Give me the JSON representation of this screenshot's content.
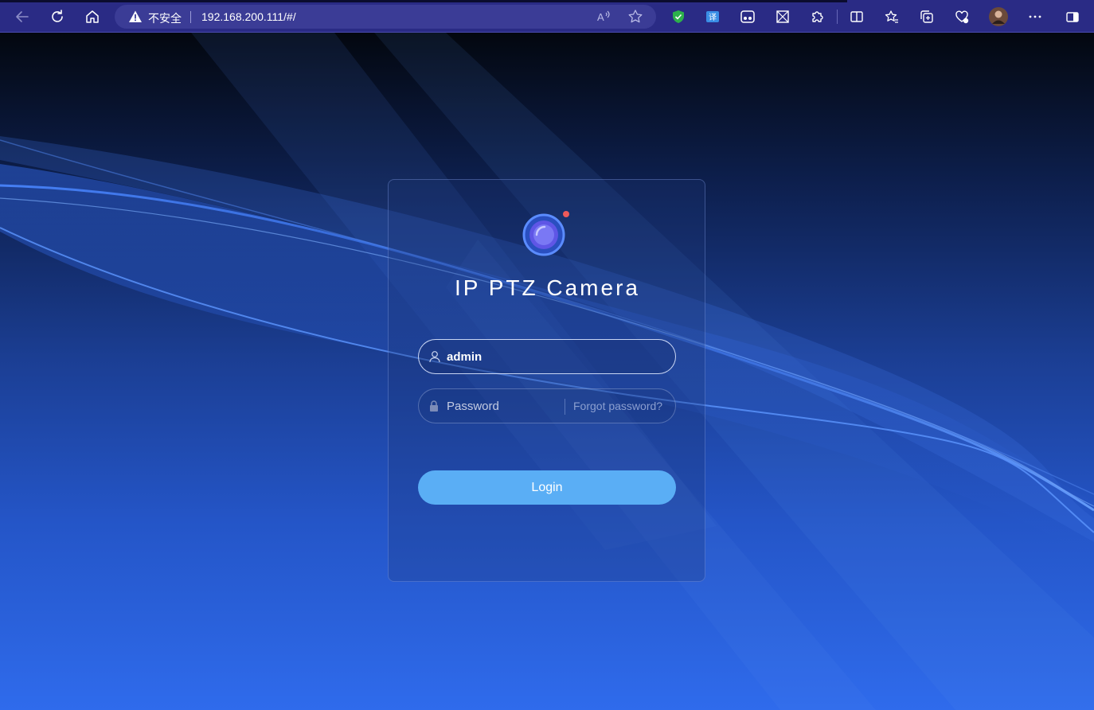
{
  "browser": {
    "security_label": "不安全",
    "url": "192.168.200.111/#/",
    "accent": "#2a2b85"
  },
  "login": {
    "title": "IP PTZ Camera",
    "username_value": "admin",
    "password_placeholder": "Password",
    "forgot_label": "Forgot password?",
    "login_label": "Login",
    "button_color": "#5aaef5"
  }
}
